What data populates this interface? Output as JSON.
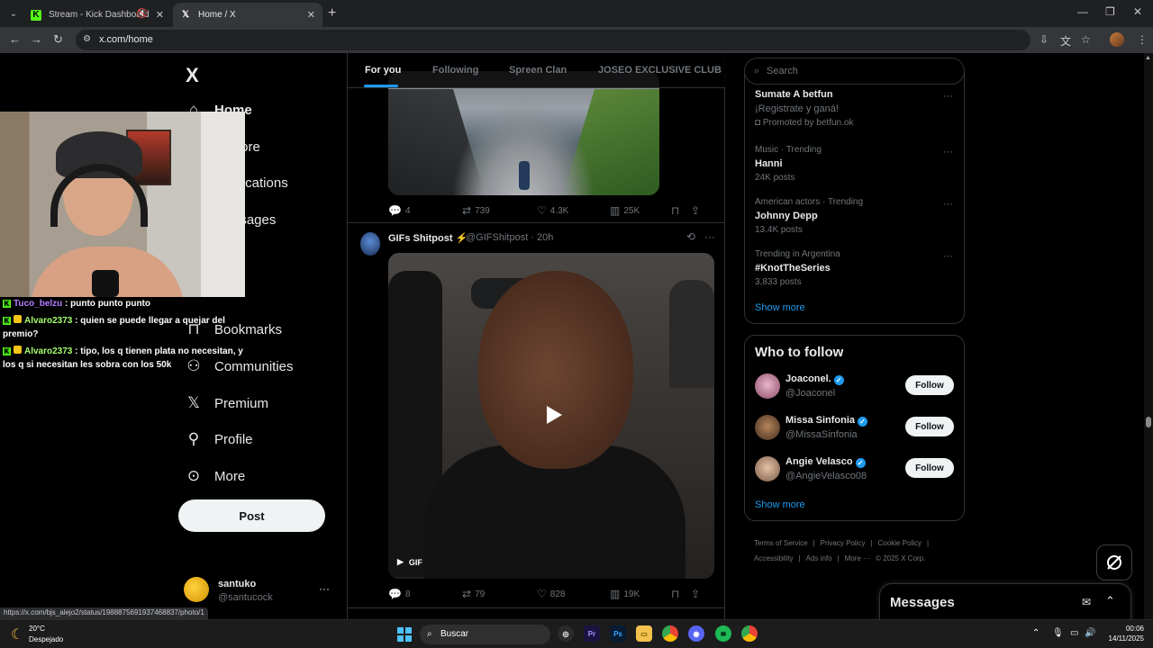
{
  "browser": {
    "tabs": [
      {
        "title": "Stream - Kick Dashboard",
        "active": false,
        "muted": true
      },
      {
        "title": "Home / X",
        "active": true
      }
    ],
    "url": "x.com/home",
    "status_url": "https://x.com/bjs_alejo2/status/1988875691937468837/photo/1"
  },
  "nav": {
    "logo": "X",
    "items": [
      {
        "label": "Home",
        "icon": "home-icon"
      },
      {
        "label": "Explore",
        "icon": "search-icon"
      },
      {
        "label": "Notifications",
        "icon": "bell-icon"
      },
      {
        "label": "Messages",
        "icon": "mail-icon"
      },
      {
        "label": "Bookmarks",
        "icon": "bookmark-icon"
      },
      {
        "label": "Communities",
        "icon": "people-icon"
      },
      {
        "label": "Premium",
        "icon": "x-icon"
      },
      {
        "label": "Profile",
        "icon": "person-icon"
      },
      {
        "label": "More",
        "icon": "more-circle-icon"
      }
    ],
    "post_label": "Post",
    "account": {
      "name": "santuko",
      "handle": "@santucock"
    }
  },
  "chat": [
    {
      "user": "Tuco_belzu",
      "text": " : punto punto punto"
    },
    {
      "user": "Alvaro2373",
      "text": " : quien se puede llegar a quejar del premio?"
    },
    {
      "user": "Alvaro2373",
      "text": " : tipo, los q tienen plata no necesitan, y los q si necesitan les sobra con los 50k"
    }
  ],
  "timeline": {
    "tabs": [
      "For you",
      "Following",
      "Spreen Clan",
      "JOSEO EXCLUSIVE CLUB"
    ],
    "active_tab": "For you",
    "post1_stats": {
      "replies": "4",
      "reposts": "739",
      "likes": "4.3K",
      "views": "25K"
    },
    "post2": {
      "name": "GIFs Shitpost ⚡",
      "handle": "@GIFShitpost · 20h",
      "media_badge": "GIF",
      "stats": {
        "replies": "8",
        "reposts": "79",
        "likes": "828",
        "views": "19K"
      }
    }
  },
  "right": {
    "search_placeholder": "Search",
    "trends": [
      {
        "meta": "",
        "name": "Sumate A betfun",
        "sub": "¡Registrate y ganá!",
        "count": "Promoted by betfun.ok"
      },
      {
        "meta": "Music · Trending",
        "name": "Hanni",
        "sub": "",
        "count": "24K posts"
      },
      {
        "meta": "American actors · Trending",
        "name": "Johnny Depp",
        "sub": "",
        "count": "13.4K posts"
      },
      {
        "meta": "Trending in Argentina",
        "name": "#KnotTheSeries",
        "sub": "",
        "count": "3,833 posts"
      }
    ],
    "show_more": "Show more",
    "who_to_follow_title": "Who to follow",
    "follow": [
      {
        "name": "Joaconel.",
        "handle": "@Joaconel",
        "button": "Follow"
      },
      {
        "name": "Missa Sinfonia",
        "handle": "@MissaSinfonia",
        "button": "Follow"
      },
      {
        "name": "Angie Velasco",
        "handle": "@AngieVelasco08",
        "button": "Follow"
      }
    ],
    "footer": [
      "Terms of Service",
      "|",
      "Privacy Policy",
      "|",
      "Cookie Policy",
      "|",
      "Accessibility",
      "|",
      "Ads info",
      "|",
      "More ···",
      "© 2025 X Corp."
    ]
  },
  "messages": {
    "title": "Messages"
  },
  "taskbar": {
    "temp": "20°C",
    "condition": "Despejado",
    "search_placeholder": "Buscar",
    "time": "00:06",
    "date": "14/11/2025"
  },
  "colors": {
    "accent": "#1d9bf0",
    "kick": "#53fc18",
    "background": "#000000"
  }
}
